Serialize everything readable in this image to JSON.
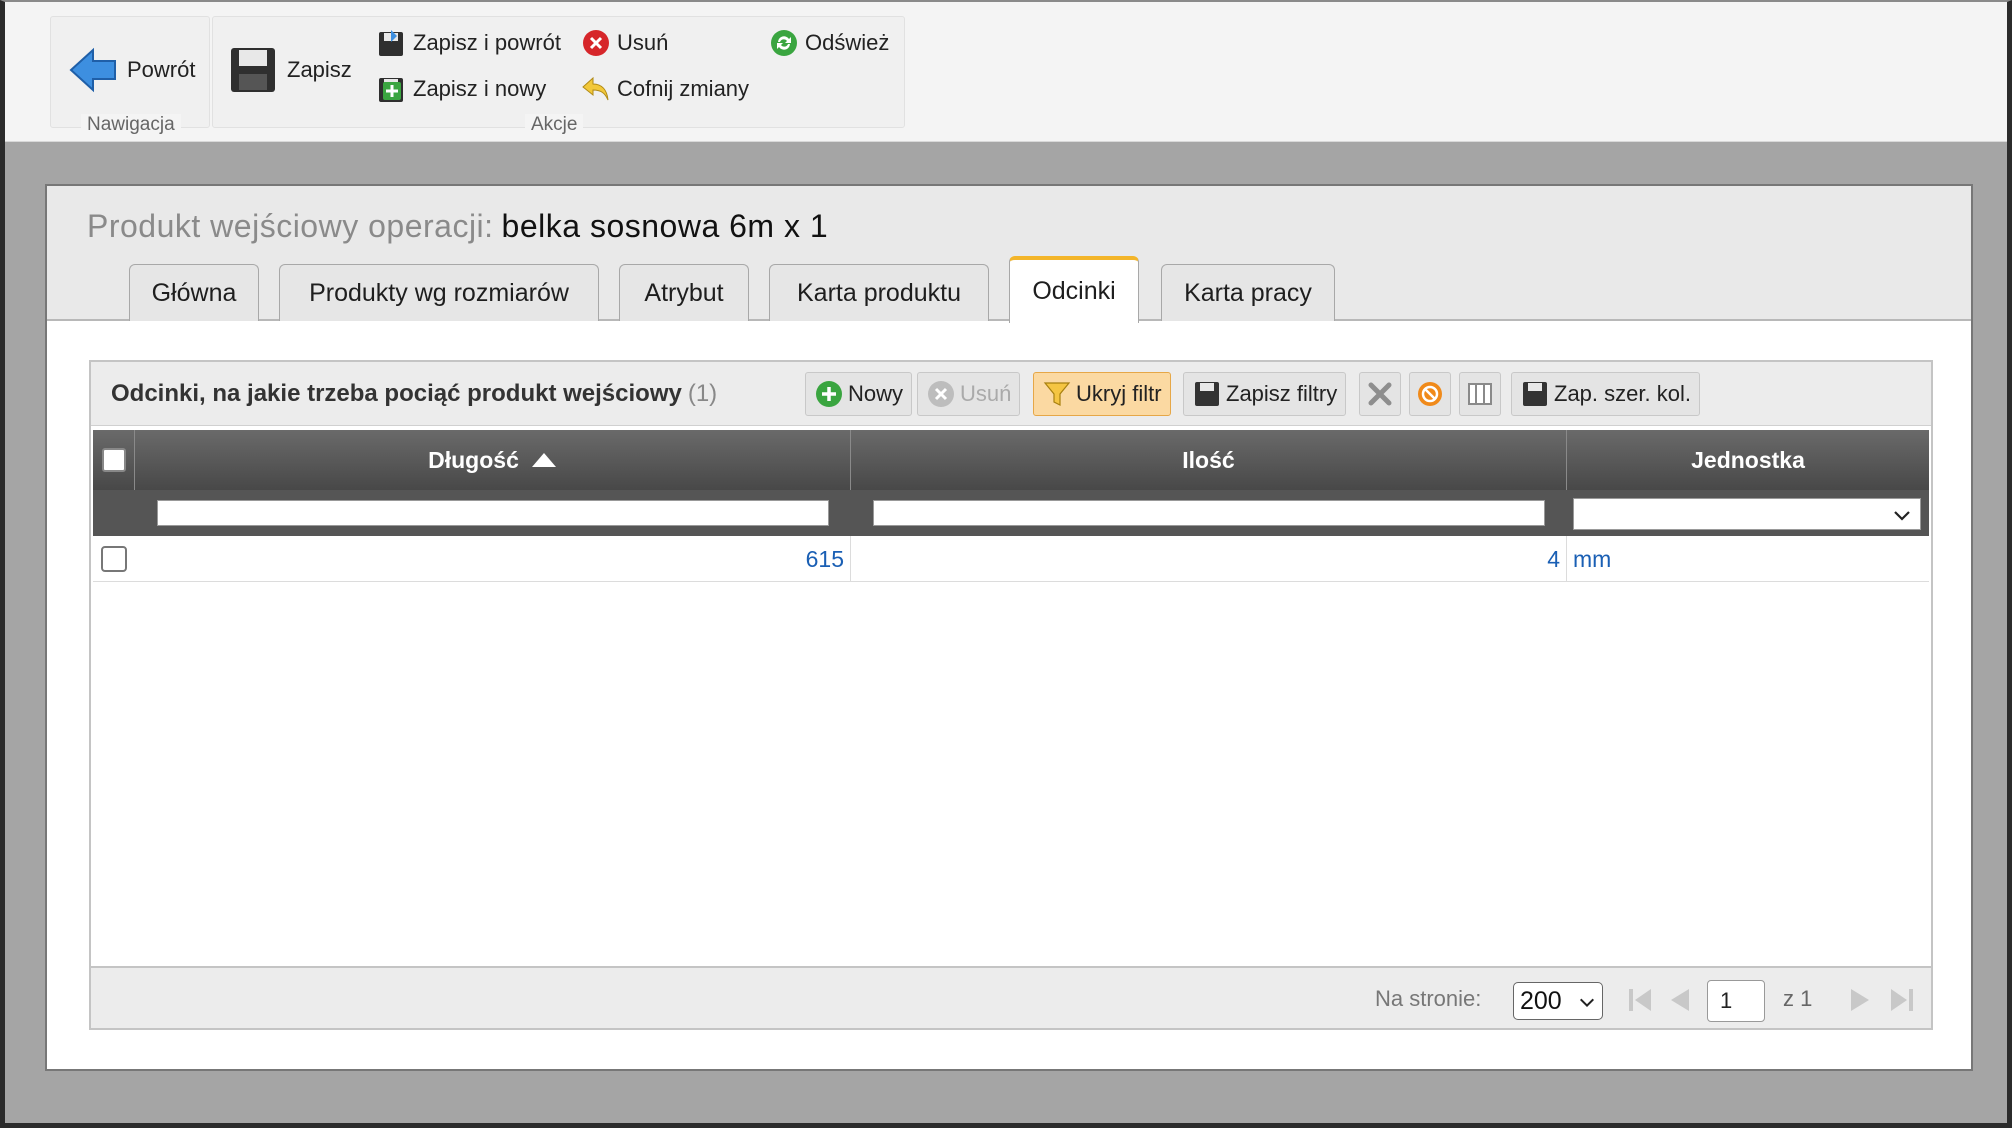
{
  "ribbon": {
    "nav": {
      "back_label": "Powrót",
      "caption": "Nawigacja"
    },
    "actions": {
      "save_label": "Zapisz",
      "save_back_label": "Zapisz i powrót",
      "save_new_label": "Zapisz i nowy",
      "delete_label": "Usuń",
      "undo_label": "Cofnij zmiany",
      "refresh_label": "Odśwież",
      "caption": "Akcje"
    }
  },
  "dialog": {
    "title_label": "Produkt wejściowy operacji:",
    "title_value": "belka sosnowa 6m x 1",
    "tabs": [
      {
        "label": "Główna"
      },
      {
        "label": "Produkty wg rozmiarów"
      },
      {
        "label": "Atrybut"
      },
      {
        "label": "Karta produktu"
      },
      {
        "label": "Odcinki",
        "active": true
      },
      {
        "label": "Karta pracy"
      }
    ]
  },
  "grid": {
    "title": "Odcinki, na jakie trzeba pociąć produkt wejściowy",
    "count": "(1)",
    "toolbar": {
      "new_label": "Nowy",
      "delete_label": "Usuń",
      "hide_filter_label": "Ukryj filtr",
      "save_filters_label": "Zapisz filtry",
      "save_widths_label": "Zap. szer. kol."
    },
    "columns": [
      "Długość",
      "Ilość",
      "Jednostka"
    ],
    "sort": {
      "column": "Długość",
      "direction": "ascending"
    },
    "rows": [
      {
        "length": "615",
        "quantity": "4",
        "unit": "mm"
      }
    ],
    "footer": {
      "per_page_label": "Na stronie:",
      "per_page_value": "200",
      "page_value": "1",
      "page_of": "z 1"
    }
  },
  "colors": {
    "accent_tab": "#f3b52a",
    "header_bg": "#555555",
    "link_value": "#1a5fb4",
    "active_button": "#fbd9a2"
  }
}
